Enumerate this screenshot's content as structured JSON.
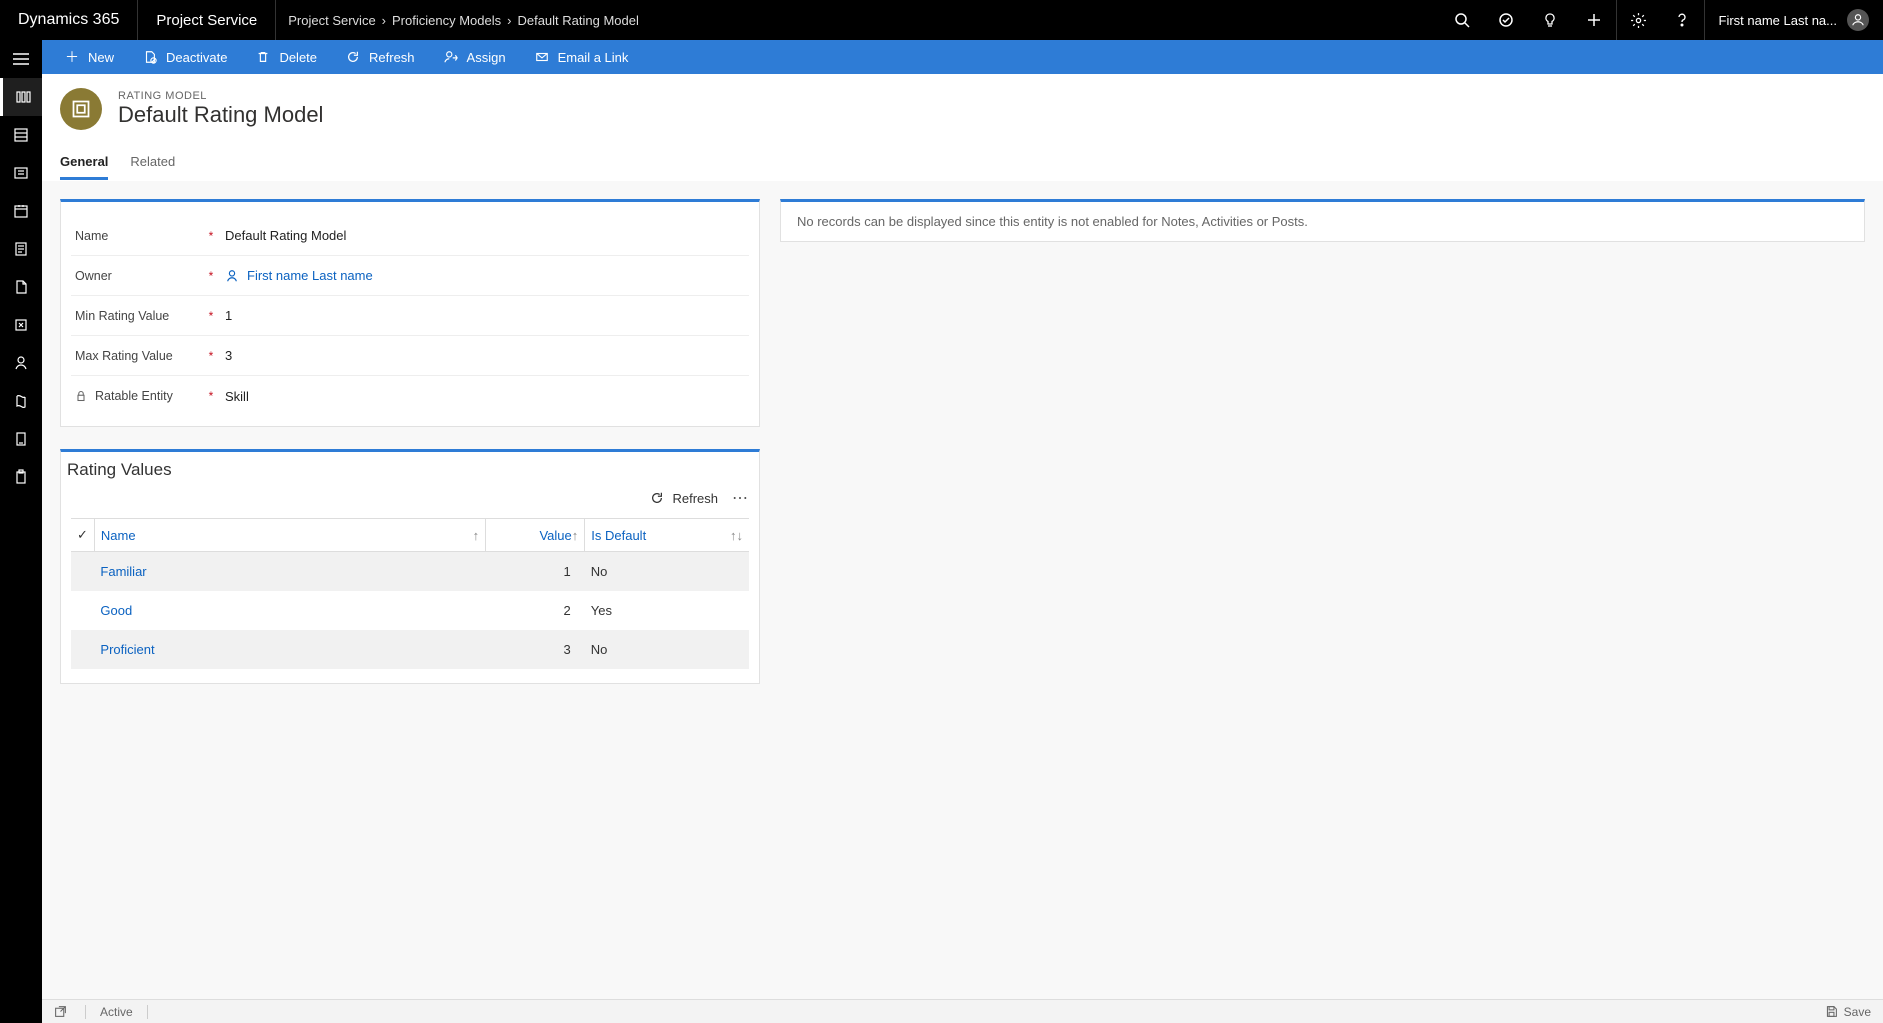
{
  "topbar": {
    "brand": "Dynamics 365",
    "app": "Project Service",
    "breadcrumb": [
      "Project Service",
      "Proficiency Models",
      "Default Rating Model"
    ],
    "username": "First name Last na..."
  },
  "commands": {
    "new": "New",
    "deactivate": "Deactivate",
    "delete": "Delete",
    "refresh": "Refresh",
    "assign": "Assign",
    "email": "Email a Link"
  },
  "header": {
    "entity": "RATING MODEL",
    "title": "Default Rating Model"
  },
  "tabs": {
    "general": "General",
    "related": "Related"
  },
  "form": {
    "labels": {
      "name": "Name",
      "owner": "Owner",
      "min": "Min Rating Value",
      "max": "Max Rating Value",
      "ratable": "Ratable Entity"
    },
    "values": {
      "name": "Default Rating Model",
      "owner": "First name Last name",
      "min": "1",
      "max": "3",
      "ratable": "Skill"
    }
  },
  "grid": {
    "title": "Rating Values",
    "refresh": "Refresh",
    "cols": {
      "name": "Name",
      "value": "Value",
      "isdefault": "Is Default"
    },
    "rows": [
      {
        "name": "Familiar",
        "value": "1",
        "isdefault": "No"
      },
      {
        "name": "Good",
        "value": "2",
        "isdefault": "Yes"
      },
      {
        "name": "Proficient",
        "value": "3",
        "isdefault": "No"
      }
    ]
  },
  "notes": {
    "empty": "No records can be displayed since this entity is not enabled for Notes, Activities or Posts."
  },
  "footer": {
    "status": "Active",
    "save": "Save"
  }
}
